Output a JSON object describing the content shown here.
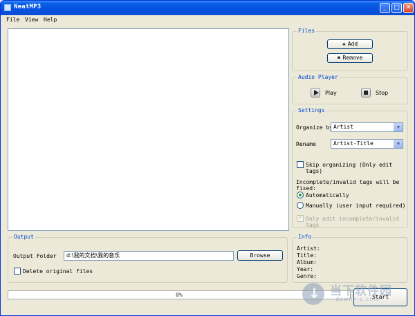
{
  "window": {
    "title": "NeatMP3"
  },
  "titlebar_buttons": {
    "minimize": "_",
    "maximize": "□",
    "close": "✕"
  },
  "menu": [
    {
      "label": "File"
    },
    {
      "label": "View"
    },
    {
      "label": "Help"
    }
  ],
  "files_group": {
    "title": "Files",
    "add_label": "Add",
    "remove_label": "Remove",
    "add_icon": "plus-icon",
    "remove_icon": "x-icon"
  },
  "audio_player": {
    "title": "Audio Player",
    "play_label": "Play",
    "stop_label": "Stop"
  },
  "settings": {
    "title": "Settings",
    "organize_by_label": "Organize by",
    "organize_by_value": "Artist",
    "rename_label": "Rename",
    "rename_value": "Artist-Title",
    "skip_organizing_label": "Skip organizing (Only edit tags)",
    "incomplete_tags_label": "Incomplete/invalid tags will be fixed:",
    "auto_label": "Automatically",
    "manual_label": "Manually (user input required)",
    "only_edit_label": "Only edit incomplete/invalid tags"
  },
  "output": {
    "title": "Output",
    "folder_label": "Output Folder",
    "folder_value": "d:\\我的文档\\我的音乐",
    "browse_label": "Browse",
    "delete_original_label": "Delete original files"
  },
  "info": {
    "title": "Info",
    "artist_label": "Artist:",
    "title_label": "Title:",
    "album_label": "Album:",
    "year_label": "Year:",
    "genre_label": "Genre:"
  },
  "progress": {
    "value": 0,
    "text": "0%"
  },
  "start_label": "Start",
  "watermark": {
    "cn": "当下软件园",
    "en": "downxia.com"
  }
}
